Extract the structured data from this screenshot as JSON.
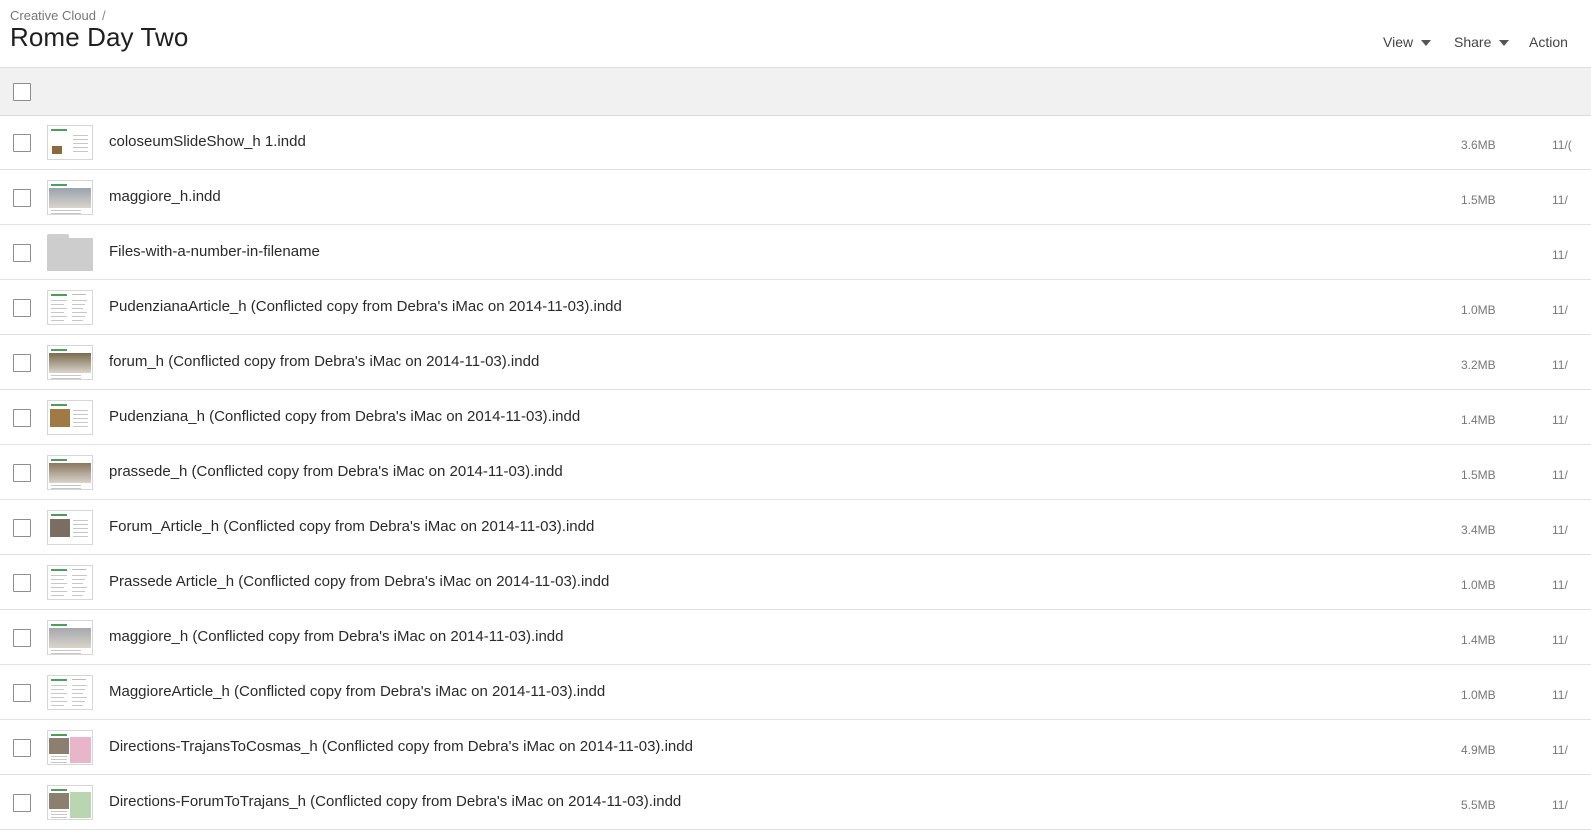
{
  "header": {
    "breadcrumb": "Creative Cloud",
    "breadcrumb_sep": "/",
    "title": "Rome Day Two",
    "actions": {
      "view": "View",
      "share": "Share",
      "actions": "Action"
    }
  },
  "files": [
    {
      "name": "coloseumSlideShow_h 1.indd",
      "size": "3.6MB",
      "date": "11/(",
      "thumb": "doc-photo-small",
      "accent": "#8a6a3c"
    },
    {
      "name": "maggiore_h.indd",
      "size": "1.5MB",
      "date": "11/",
      "thumb": "photo",
      "accent": "#9aa3ad"
    },
    {
      "name": "Files-with-a-number-in-filename",
      "size": "",
      "date": "11/",
      "thumb": "folder",
      "accent": "#cdcdcd"
    },
    {
      "name": "PudenzianaArticle_h (Conflicted copy from Debra's iMac on 2014-11-03).indd",
      "size": "1.0MB",
      "date": "11/",
      "thumb": "text",
      "accent": "#cccccc"
    },
    {
      "name": "forum_h (Conflicted copy from Debra's iMac on 2014-11-03).indd",
      "size": "3.2MB",
      "date": "11/",
      "thumb": "photo",
      "accent": "#7b6a4f"
    },
    {
      "name": "Pudenziana_h (Conflicted copy from Debra's iMac on 2014-11-03).indd",
      "size": "1.4MB",
      "date": "11/",
      "thumb": "doc-photo",
      "accent": "#a07a45"
    },
    {
      "name": "prassede_h (Conflicted copy from Debra's iMac on 2014-11-03).indd",
      "size": "1.5MB",
      "date": "11/",
      "thumb": "photo",
      "accent": "#8b7760"
    },
    {
      "name": "Forum_Article_h (Conflicted copy from Debra's iMac on 2014-11-03).indd",
      "size": "3.4MB",
      "date": "11/",
      "thumb": "doc-photo",
      "accent": "#7a6d62"
    },
    {
      "name": "Prassede Article_h (Conflicted copy from Debra's iMac on 2014-11-03).indd",
      "size": "1.0MB",
      "date": "11/",
      "thumb": "text",
      "accent": "#cccccc"
    },
    {
      "name": "maggiore_h (Conflicted copy from Debra's iMac on 2014-11-03).indd",
      "size": "1.4MB",
      "date": "11/",
      "thumb": "photo",
      "accent": "#a5a8ac"
    },
    {
      "name": "MaggioreArticle_h (Conflicted copy from Debra's iMac on 2014-11-03).indd",
      "size": "1.0MB",
      "date": "11/",
      "thumb": "text",
      "accent": "#cccccc"
    },
    {
      "name": "Directions-TrajansToCosmas_h (Conflicted copy from Debra's iMac on 2014-11-03).indd",
      "size": "4.9MB",
      "date": "11/",
      "thumb": "map",
      "accent": "#e8b6c8"
    },
    {
      "name": "Directions-ForumToTrajans_h (Conflicted copy from Debra's iMac on 2014-11-03).indd",
      "size": "5.5MB",
      "date": "11/",
      "thumb": "map",
      "accent": "#b9d6b0"
    }
  ]
}
